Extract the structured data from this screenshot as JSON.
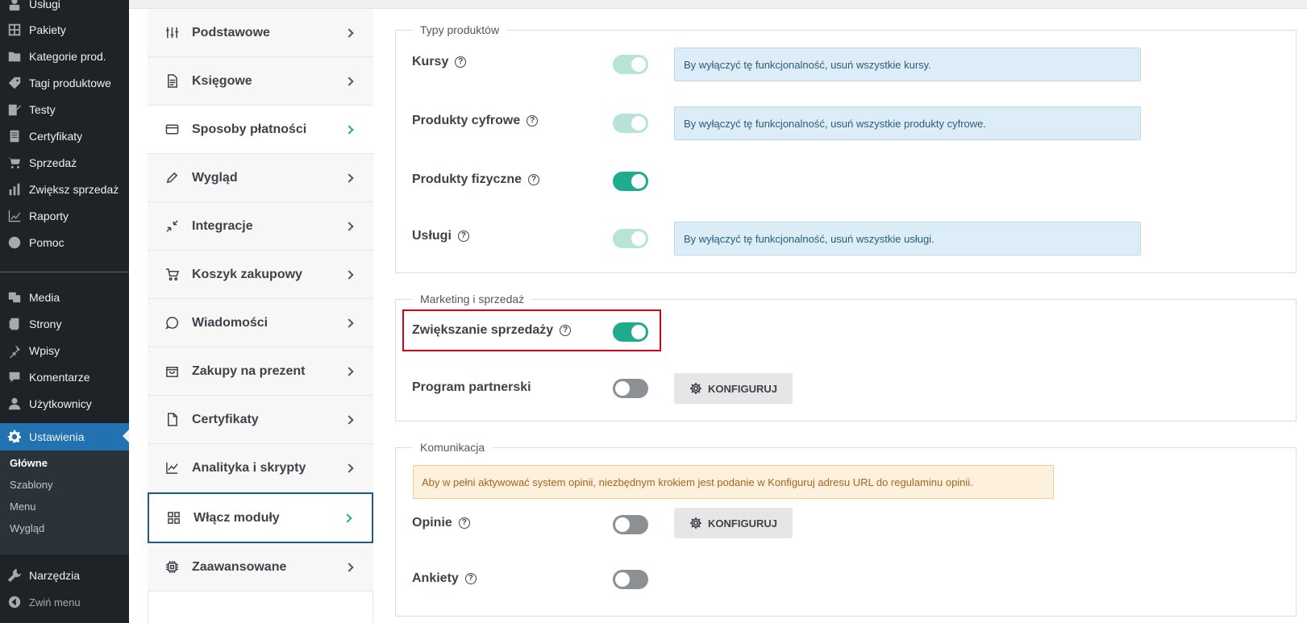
{
  "admin_menu": {
    "items": [
      {
        "label": "Usługi",
        "icon": "services-icon"
      },
      {
        "label": "Pakiety",
        "icon": "packages-grid-icon"
      },
      {
        "label": "Kategorie prod.",
        "icon": "folder-icon"
      },
      {
        "label": "Tagi produktowe",
        "icon": "tag-icon"
      },
      {
        "label": "Testy",
        "icon": "test-edit-icon"
      },
      {
        "label": "Certyfikaty",
        "icon": "certificate-document-icon"
      },
      {
        "label": "Sprzedaż",
        "icon": "cart-icon"
      },
      {
        "label": "Zwiększ sprzedaż",
        "icon": "bar-chart-icon"
      },
      {
        "label": "Raporty",
        "icon": "line-chart-icon"
      },
      {
        "label": "Pomoc",
        "icon": "help-circle-icon"
      },
      {
        "label": "Media",
        "icon": "media-icon"
      },
      {
        "label": "Strony",
        "icon": "pages-icon"
      },
      {
        "label": "Wpisy",
        "icon": "pin-icon"
      },
      {
        "label": "Komentarze",
        "icon": "comment-icon"
      },
      {
        "label": "Użytkownicy",
        "icon": "user-icon"
      },
      {
        "label": "Ustawienia",
        "icon": "settings-gear-icon"
      },
      {
        "label": "Narzędzia",
        "icon": "wrench-icon"
      },
      {
        "label": "Zwiń menu",
        "icon": "collapse-arrow-icon"
      }
    ],
    "submenu": [
      "Główne",
      "Szablony",
      "Menu",
      "Wygląd"
    ]
  },
  "settings_nav": [
    {
      "label": "Podstawowe",
      "icon": "sliders-icon"
    },
    {
      "label": "Księgowe",
      "icon": "document-icon"
    },
    {
      "label": "Sposoby płatności",
      "icon": "credit-card-icon"
    },
    {
      "label": "Wygląd",
      "icon": "pencil-icon"
    },
    {
      "label": "Integracje",
      "icon": "arrows-in-icon"
    },
    {
      "label": "Koszyk zakupowy",
      "icon": "cart-icon"
    },
    {
      "label": "Wiadomości",
      "icon": "message-icon"
    },
    {
      "label": "Zakupy na prezent",
      "icon": "gift-bag-icon"
    },
    {
      "label": "Certyfikaty",
      "icon": "file-icon"
    },
    {
      "label": "Analityka i skrypty",
      "icon": "analytics-icon"
    },
    {
      "label": "Włącz moduły",
      "icon": "modules-grid-icon"
    },
    {
      "label": "Zaawansowane",
      "icon": "chip-icon"
    }
  ],
  "product_types": {
    "legend": "Typy produktów",
    "rows": [
      {
        "label": "Kursy",
        "state": "on-disabled",
        "info": "By wyłączyć tę funkcjonalność, usuń wszystkie kursy."
      },
      {
        "label": "Produkty cyfrowe",
        "state": "on-disabled",
        "info": "By wyłączyć tę funkcjonalność, usuń wszystkie produkty cyfrowe."
      },
      {
        "label": "Produkty fizyczne",
        "state": "on",
        "info": ""
      },
      {
        "label": "Usługi",
        "state": "on-disabled",
        "info": "By wyłączyć tę funkcjonalność, usuń wszystkie usługi."
      }
    ]
  },
  "marketing": {
    "legend": "Marketing i sprzedaż",
    "rows": [
      {
        "label": "Zwiększanie sprzedaży",
        "state": "on"
      },
      {
        "label": "Program partnerski",
        "state": "off",
        "button": "KONFIGURUJ"
      }
    ]
  },
  "communication": {
    "legend": "Komunikacja",
    "warning": "Aby w pełni aktywować system opinii, niezbędnym krokiem jest podanie w Konfiguruj adresu URL do regulaminu opinii.",
    "rows": [
      {
        "label": "Opinie",
        "state": "off",
        "button": "KONFIGURUJ"
      },
      {
        "label": "Ankiety",
        "state": "off"
      }
    ]
  },
  "colors": {
    "accent": "#1eab8e",
    "wp_blue": "#2271b1",
    "highlight": "#d0021b"
  }
}
